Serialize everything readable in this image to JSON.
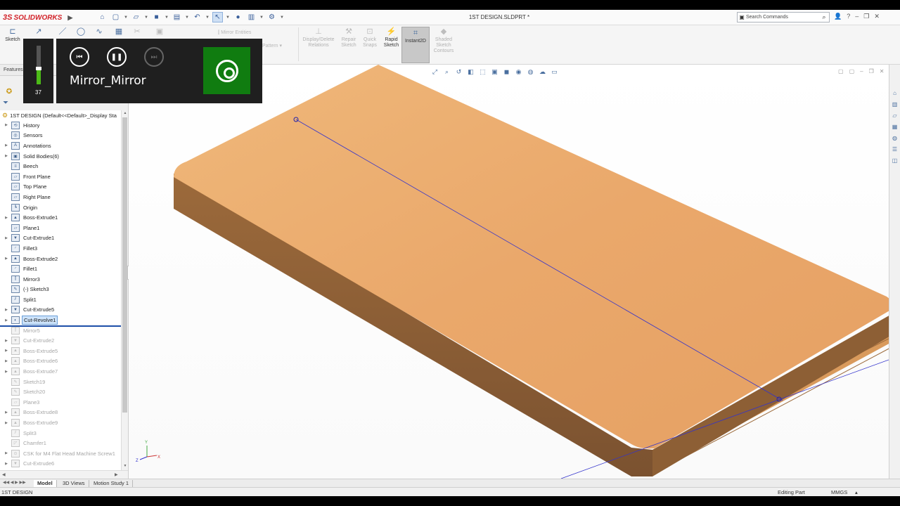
{
  "app": {
    "name": "SOLIDWORKS",
    "document_title": "1ST DESIGN.SLDPRT *"
  },
  "search": {
    "placeholder": "Search Commands"
  },
  "toolbar": {
    "sketch": "Sketch",
    "mirror_entities": "Mirror Entities",
    "pattern": "Pattern",
    "display_delete_relations": "Display/Delete Relations",
    "repair_sketch": "Repair Sketch",
    "quick_snaps": "Quick Snaps",
    "rapid_sketch": "Rapid Sketch",
    "instant2d": "Instant2D",
    "shaded_sketch_contours": "Shaded Sketch Contours"
  },
  "feature_manager": {
    "tab_label": "Features",
    "root": "1ST DESIGN  (Default<<Default>_Display Sta",
    "items": [
      {
        "label": "History",
        "expandable": true,
        "icon": "history-icon",
        "state": "normal"
      },
      {
        "label": "Sensors",
        "expandable": false,
        "icon": "sensor-icon",
        "state": "normal"
      },
      {
        "label": "Annotations",
        "expandable": true,
        "icon": "annotation-icon",
        "state": "normal"
      },
      {
        "label": "Solid Bodies(6)",
        "expandable": true,
        "icon": "solid-bodies-icon",
        "state": "normal"
      },
      {
        "label": "Beech",
        "expandable": false,
        "icon": "material-icon",
        "state": "normal"
      },
      {
        "label": "Front Plane",
        "expandable": false,
        "icon": "plane-icon",
        "state": "normal"
      },
      {
        "label": "Top Plane",
        "expandable": false,
        "icon": "plane-icon",
        "state": "normal"
      },
      {
        "label": "Right Plane",
        "expandable": false,
        "icon": "plane-icon",
        "state": "normal"
      },
      {
        "label": "Origin",
        "expandable": false,
        "icon": "origin-icon",
        "state": "normal"
      },
      {
        "label": "Boss-Extrude1",
        "expandable": true,
        "icon": "boss-extrude-icon",
        "state": "normal"
      },
      {
        "label": "Plane1",
        "expandable": false,
        "icon": "plane-icon",
        "state": "normal"
      },
      {
        "label": "Cut-Extrude1",
        "expandable": true,
        "icon": "cut-extrude-icon",
        "state": "normal"
      },
      {
        "label": "Fillet3",
        "expandable": false,
        "icon": "fillet-icon",
        "state": "normal"
      },
      {
        "label": "Boss-Extrude2",
        "expandable": true,
        "icon": "boss-extrude-icon",
        "state": "normal"
      },
      {
        "label": "Fillet1",
        "expandable": false,
        "icon": "fillet-icon",
        "state": "normal"
      },
      {
        "label": "Mirror3",
        "expandable": false,
        "icon": "mirror-icon",
        "state": "normal"
      },
      {
        "label": "(-) Sketch3",
        "expandable": false,
        "icon": "sketch-icon",
        "state": "normal"
      },
      {
        "label": "Split1",
        "expandable": false,
        "icon": "split-icon",
        "state": "normal"
      },
      {
        "label": "Cut-Extrude5",
        "expandable": true,
        "icon": "cut-extrude-icon",
        "state": "normal"
      },
      {
        "label": "Cut-Revolve1",
        "expandable": true,
        "icon": "cut-revolve-icon",
        "state": "selected"
      },
      {
        "label": "Mirror5",
        "expandable": false,
        "icon": "mirror-icon",
        "state": "suppressed"
      },
      {
        "label": "Cut-Extrude2",
        "expandable": true,
        "icon": "cut-extrude-icon",
        "state": "suppressed"
      },
      {
        "label": "Boss-Extrude5",
        "expandable": true,
        "icon": "boss-extrude-icon",
        "state": "suppressed"
      },
      {
        "label": "Boss-Extrude6",
        "expandable": true,
        "icon": "boss-extrude-icon",
        "state": "suppressed"
      },
      {
        "label": "Boss-Extrude7",
        "expandable": true,
        "icon": "boss-extrude-icon",
        "state": "suppressed"
      },
      {
        "label": "Sketch19",
        "expandable": false,
        "icon": "sketch-icon",
        "state": "suppressed"
      },
      {
        "label": "Sketch20",
        "expandable": false,
        "icon": "sketch-icon",
        "state": "suppressed"
      },
      {
        "label": "Plane3",
        "expandable": false,
        "icon": "plane-icon",
        "state": "suppressed"
      },
      {
        "label": "Boss-Extrude8",
        "expandable": true,
        "icon": "boss-extrude-icon",
        "state": "suppressed"
      },
      {
        "label": "Boss-Extrude9",
        "expandable": true,
        "icon": "boss-extrude-icon",
        "state": "suppressed"
      },
      {
        "label": "Split3",
        "expandable": false,
        "icon": "split-icon",
        "state": "suppressed"
      },
      {
        "label": "Chamfer1",
        "expandable": false,
        "icon": "chamfer-icon",
        "state": "suppressed"
      },
      {
        "label": "CSK for M4 Flat Head Machine Screw1",
        "expandable": true,
        "icon": "hole-wizard-icon",
        "state": "suppressed"
      },
      {
        "label": "Cut-Extrude6",
        "expandable": true,
        "icon": "cut-extrude-icon",
        "state": "suppressed"
      }
    ]
  },
  "bottom_tabs": [
    "Model",
    "3D Views",
    "Motion Study 1"
  ],
  "status_bar": {
    "document": "1ST DESIGN",
    "mode": "Editing Part",
    "units": "MMGS"
  },
  "media_overlay": {
    "volume": 37,
    "track_title": "Mirror_Mirror"
  },
  "colors": {
    "brand_red": "#d2232a",
    "wood": "#e9aa6b",
    "sketch_line": "#3333cc",
    "media_green": "#107c10",
    "selection_blue": "#cde3fa"
  },
  "triad": {
    "y": "Y",
    "x": "X",
    "z": "Z"
  }
}
